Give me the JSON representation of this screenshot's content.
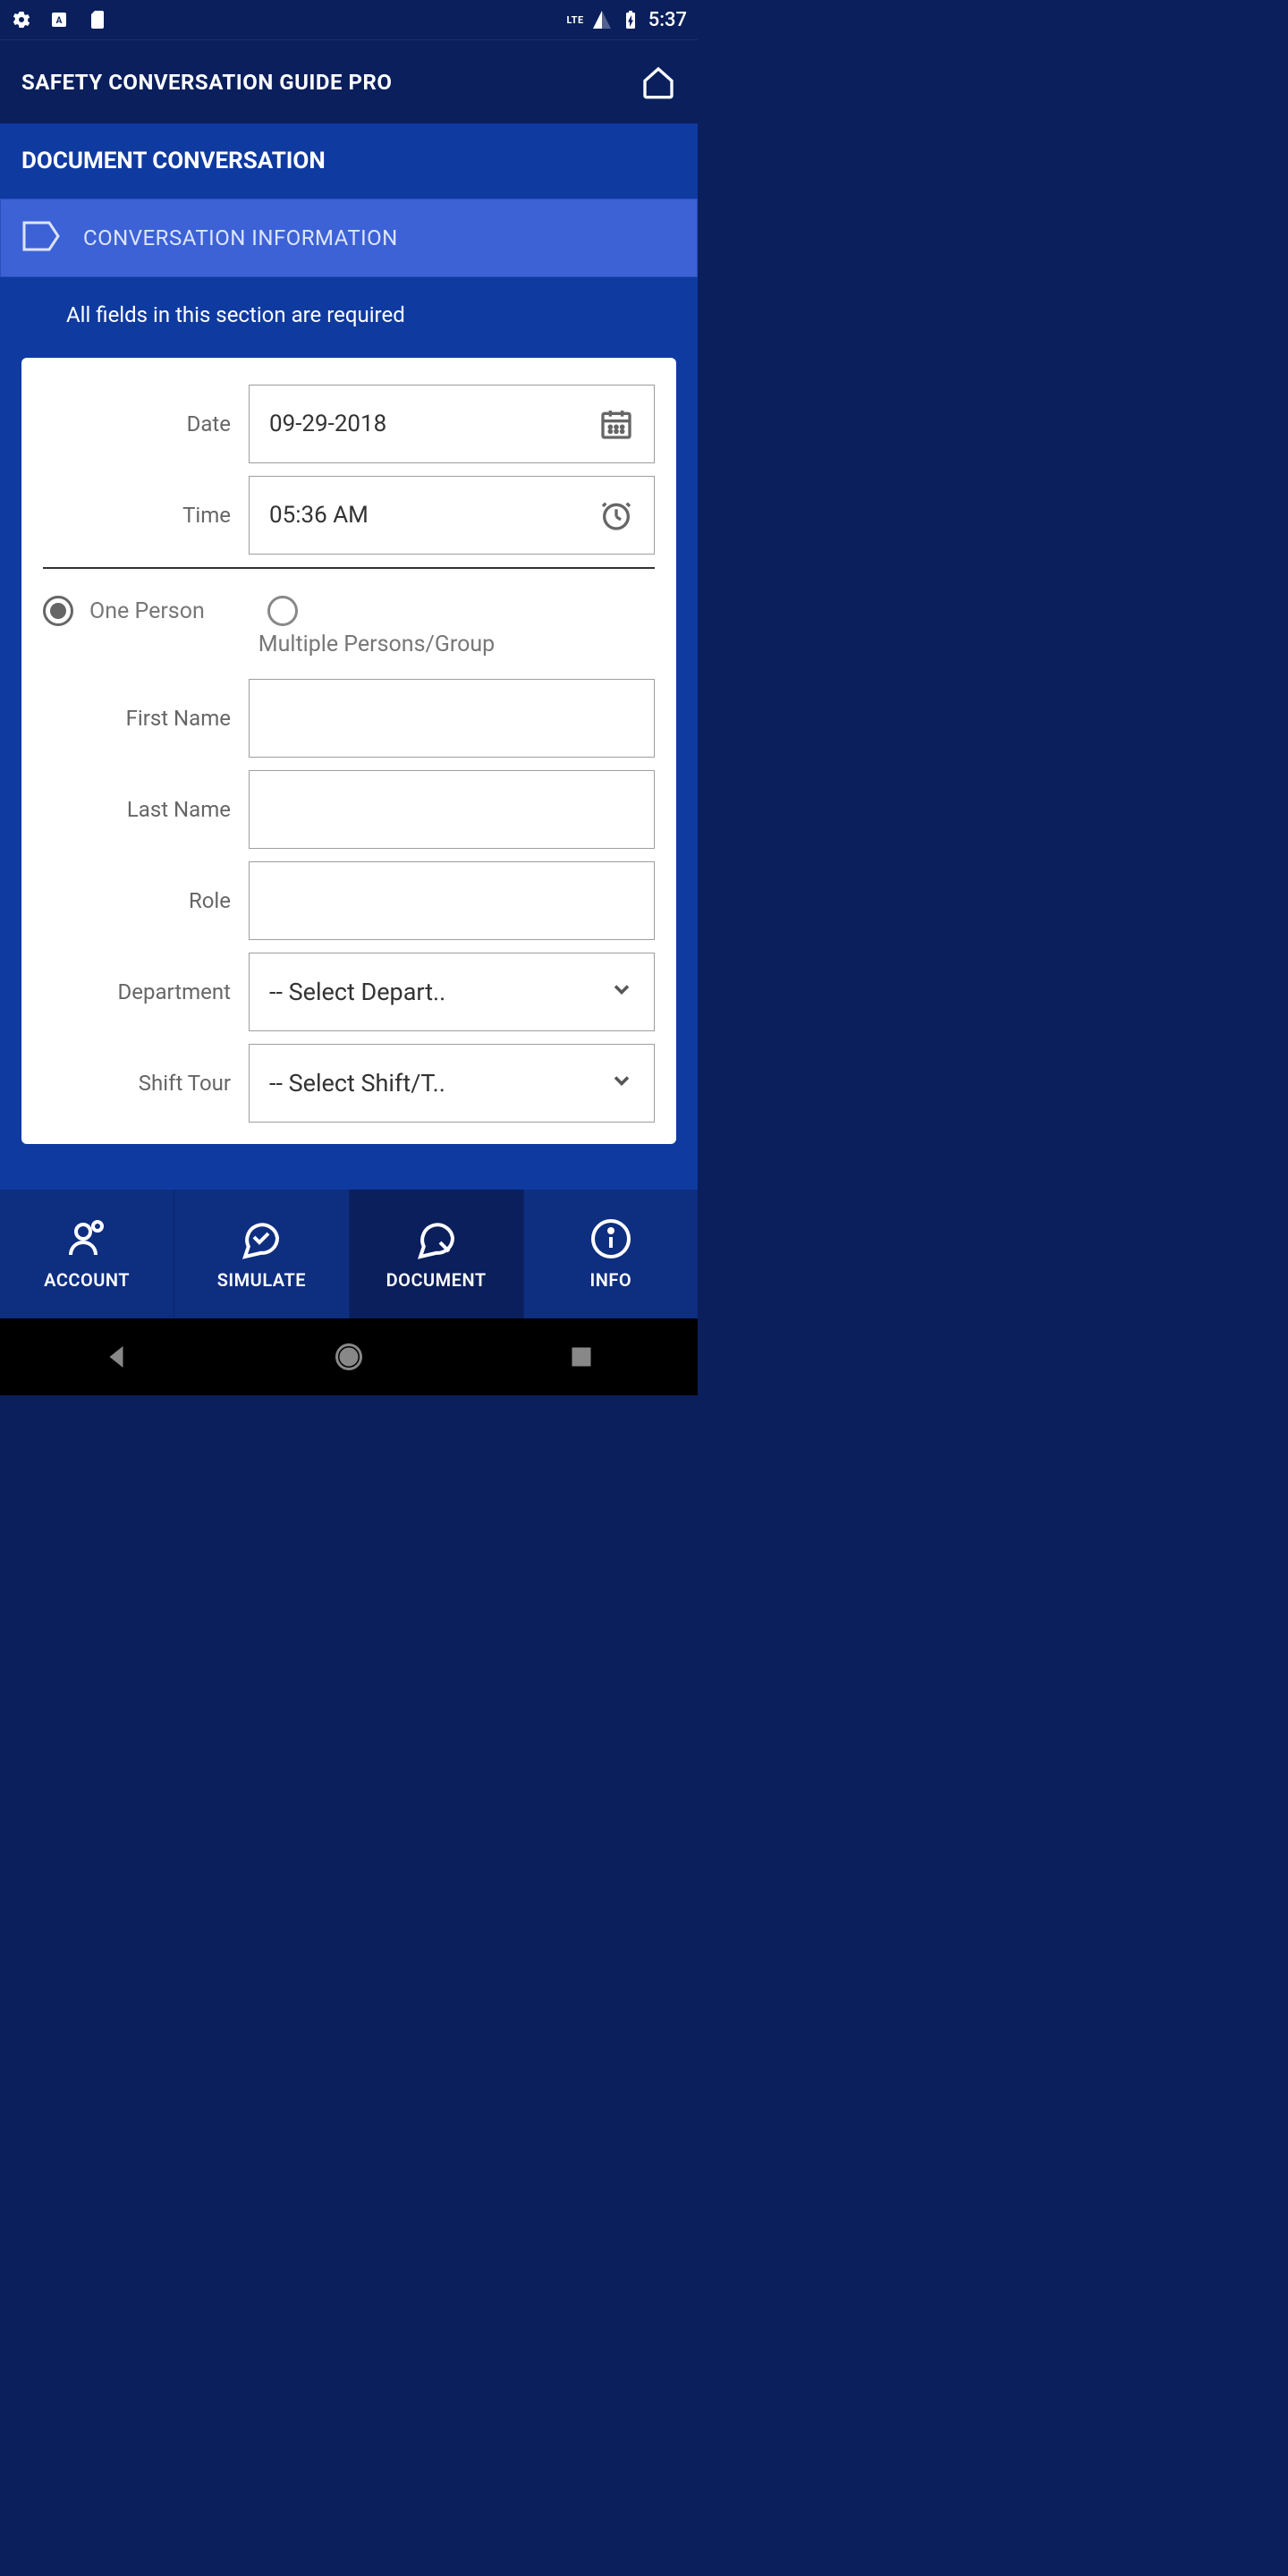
{
  "status": {
    "lte": "LTE",
    "time": "5:37"
  },
  "app": {
    "title": "SAFETY CONVERSATION GUIDE PRO"
  },
  "subheader": {
    "title": "DOCUMENT CONVERSATION"
  },
  "section": {
    "title": "CONVERSATION INFORMATION"
  },
  "helper": "All fields in this section are required",
  "form": {
    "date": {
      "label": "Date",
      "value": "09-29-2018"
    },
    "time": {
      "label": "Time",
      "value": "05:36 AM"
    },
    "radio": {
      "one": "One Person",
      "multi": "Multiple Persons/Group"
    },
    "firstName": {
      "label": "First Name",
      "value": ""
    },
    "lastName": {
      "label": "Last Name",
      "value": ""
    },
    "role": {
      "label": "Role",
      "value": ""
    },
    "department": {
      "label": "Department",
      "placeholder": "-- Select Depart.."
    },
    "shift": {
      "label": "Shift Tour",
      "placeholder": "-- Select Shift/T.."
    }
  },
  "tabs": {
    "account": "ACCOUNT",
    "simulate": "SIMULATE",
    "document": "DOCUMENT",
    "info": "INFO"
  }
}
